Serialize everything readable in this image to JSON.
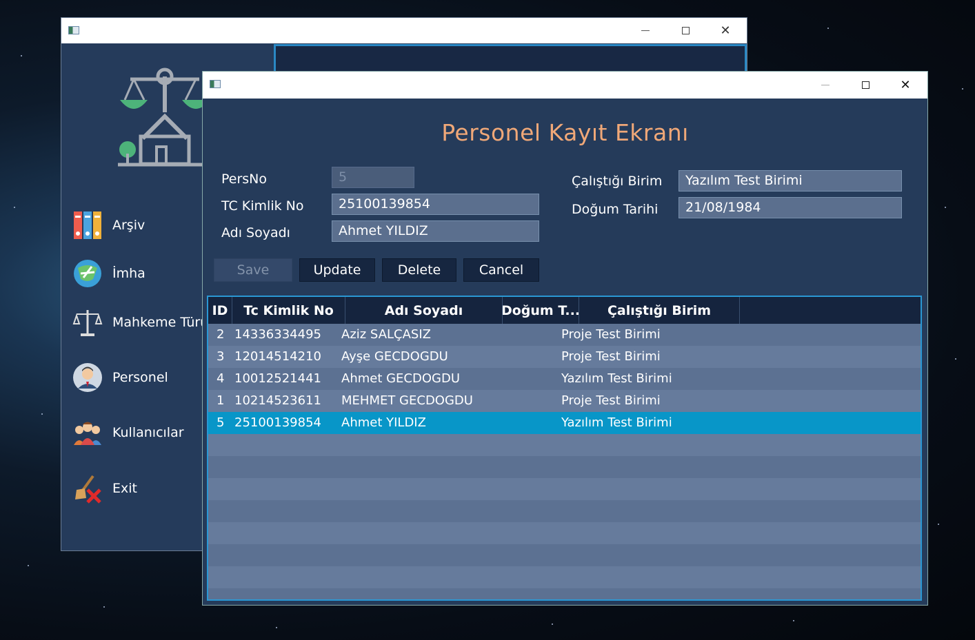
{
  "back_window": {
    "menu": [
      {
        "label": "Arşiv",
        "icon": "archive-binders-icon"
      },
      {
        "label": "İmha",
        "icon": "shredder-icon"
      },
      {
        "label": "Mahkeme Türü",
        "icon": "scales-icon"
      },
      {
        "label": "Personel",
        "icon": "person-icon"
      },
      {
        "label": "Kullanıcılar",
        "icon": "users-icon"
      },
      {
        "label": "Exit",
        "icon": "exit-broom-icon"
      }
    ]
  },
  "front_window": {
    "title": "Personel Kayıt Ekranı",
    "labels": {
      "pers_no": "PersNo",
      "tc_kimlik_no": "TC Kimlik No",
      "adi_soyadi": "Adı Soyadı",
      "calistigi_birim": "Çalıştığı Birim",
      "dogum_tarihi": "Doğum Tarihi"
    },
    "fields": {
      "pers_no": "5",
      "tc_kimlik_no": "25100139854",
      "adi_soyadi": "Ahmet YILDIZ",
      "calistigi_birim": "Yazılım Test Birimi",
      "dogum_tarihi": "21/08/1984"
    },
    "buttons": {
      "save": "Save",
      "update": "Update",
      "delete": "Delete",
      "cancel": "Cancel"
    },
    "table": {
      "columns": [
        "ID",
        "Tc Kimlik No",
        "Adı Soyadı",
        "Doğum T...",
        "Çalıştığı Birim"
      ],
      "rows": [
        {
          "id": "2",
          "tc": "14336334495",
          "name": "Aziz SALÇASIZ",
          "dogum": "",
          "birim": "Proje Test Birimi"
        },
        {
          "id": "3",
          "tc": "12014514210",
          "name": "Ayşe GECDOGDU",
          "dogum": "",
          "birim": "Proje Test Birimi"
        },
        {
          "id": "4",
          "tc": "10012521441",
          "name": "Ahmet GECDOGDU",
          "dogum": "",
          "birim": "Yazılım Test Birimi"
        },
        {
          "id": "1",
          "tc": "10214523611",
          "name": "MEHMET GECDOGDU",
          "dogum": "",
          "birim": "Proje Test Birimi"
        },
        {
          "id": "5",
          "tc": "25100139854",
          "name": "Ahmet YILDIZ",
          "dogum": "",
          "birim": "Yazılım Test Birimi",
          "selected": true
        }
      ]
    }
  }
}
